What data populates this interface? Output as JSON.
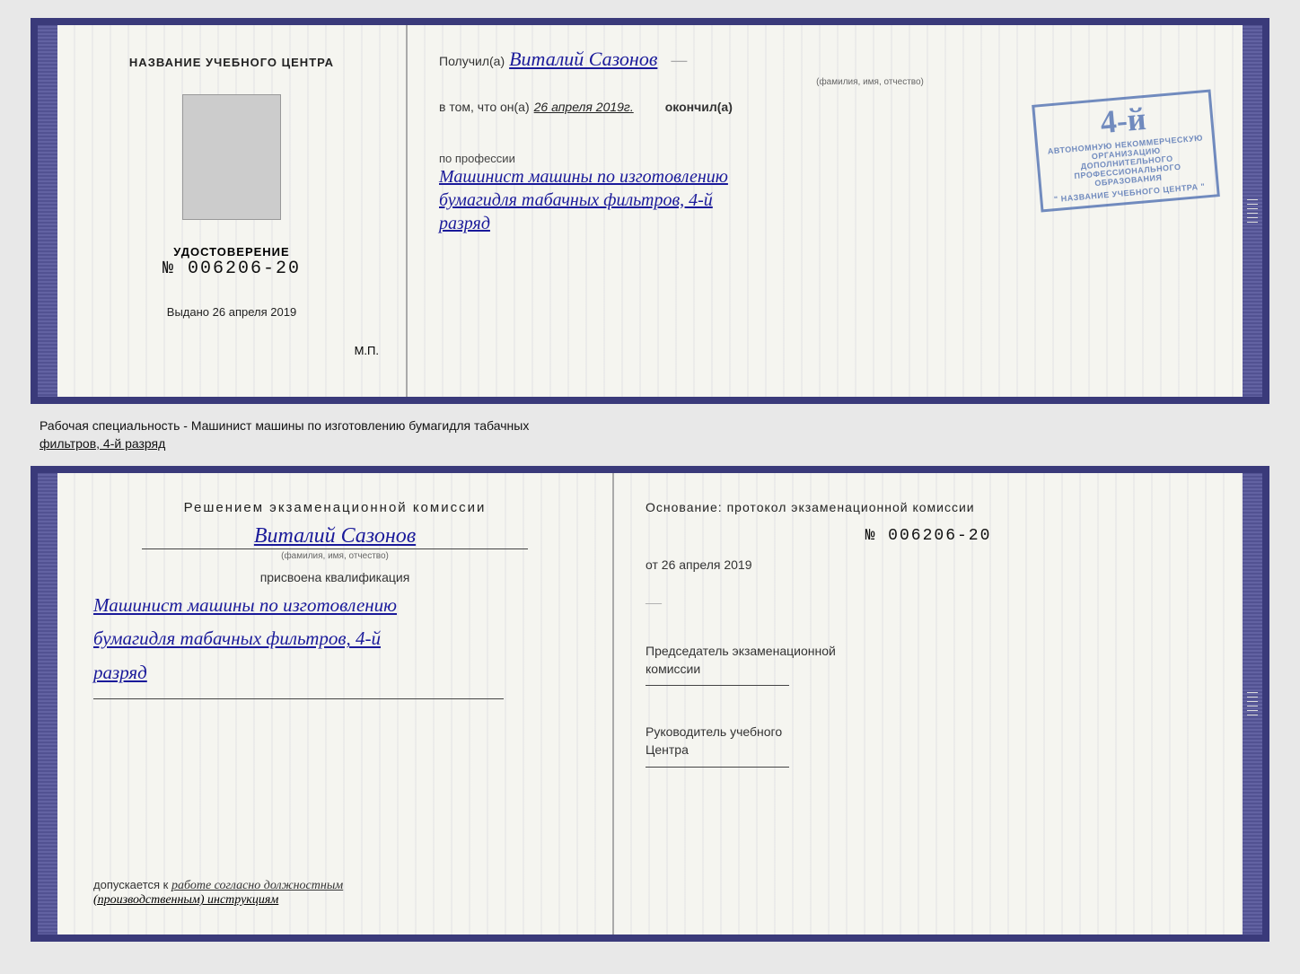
{
  "top_cert": {
    "left": {
      "title": "НАЗВАНИЕ УЧЕБНОГО ЦЕНТРА",
      "cert_label": "УДОСТОВЕРЕНИЕ",
      "cert_number": "№ 006206-20",
      "issued_label": "Выдано",
      "issued_date": "26 апреля 2019",
      "mp_label": "М.П."
    },
    "right": {
      "received_prefix": "Получил(а)",
      "recipient_name": "Виталий Сазонов",
      "recipient_subtitle": "(фамилия, имя, отчество)",
      "certify_prefix": "в том, что он(а)",
      "certify_date": "26 апреля 2019г.",
      "certify_suffix": "окончил(а)",
      "stamp": {
        "big": "4-й",
        "line1": "АВТОНОМНУЮ НЕКОММЕРЧЕСКУЮ ОРГАНИЗАЦИЮ",
        "line2": "ДОПОЛНИТЕЛЬНОГО ПРОФЕССИОНАЛЬНОГО ОБРАЗОВАНИЯ",
        "line3": "\" НАЗВАНИЕ УЧЕБНОГО ЦЕНТРА \""
      },
      "profession_label": "по профессии",
      "profession_name": "Машинист машины по изготовлению",
      "profession_name2": "бумагидля табачных фильтров, 4-й",
      "profession_name3": "разряд"
    }
  },
  "label": {
    "text": "Рабочая специальность - Машинист машины по изготовлению бумагидля табачных",
    "text2": "фильтров, 4-й разряд"
  },
  "bottom_cert": {
    "left": {
      "decision_title": "Решением  экзаменационной  комиссии",
      "person_name": "Виталий Сазонов",
      "person_subtitle": "(фамилия, имя, отчество)",
      "qualification_label": "присвоена квалификация",
      "qualification_value": "Машинист машины по изготовлению",
      "qualification_value2": "бумагидля табачных фильтров, 4-й",
      "qualification_value3": "разряд",
      "admission_prefix": "допускается к",
      "admission_value": "работе согласно должностным",
      "admission_value2": "(производственным) инструкциям"
    },
    "right": {
      "basis_label": "Основание: протокол экзаменационной  комиссии",
      "protocol_number": "№  006206-20",
      "protocol_date_prefix": "от",
      "protocol_date": "26 апреля 2019",
      "chairman_label": "Председатель экзаменационной",
      "chairman_label2": "комиссии",
      "director_label": "Руководитель учебного",
      "director_label2": "Центра"
    }
  }
}
